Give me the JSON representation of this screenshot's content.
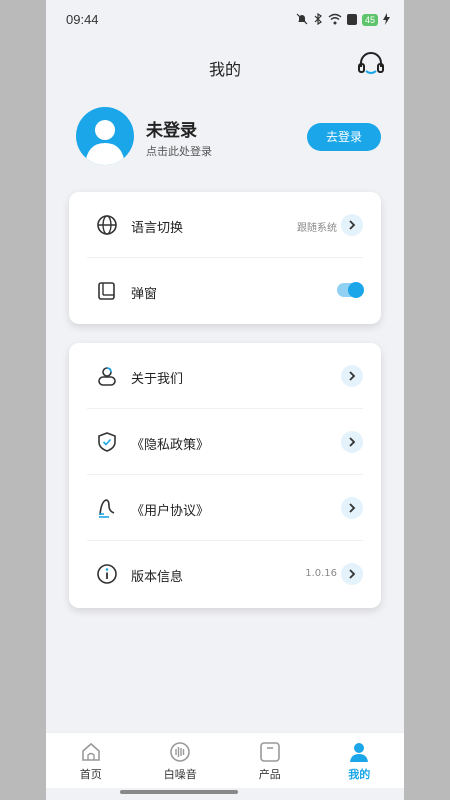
{
  "status_bar": {
    "time": "09:44",
    "battery": "45"
  },
  "header": {
    "title": "我的"
  },
  "user": {
    "name": "未登录",
    "subtitle": "点击此处登录",
    "login_button": "去登录"
  },
  "settings": {
    "language": {
      "label": "语言切换",
      "value": "跟随系统"
    },
    "popup": {
      "label": "弹窗",
      "enabled": true
    }
  },
  "info": {
    "about": {
      "label": "关于我们"
    },
    "privacy": {
      "label": "《隐私政策》"
    },
    "agreement": {
      "label": "《用户协议》"
    },
    "version": {
      "label": "版本信息",
      "value": "1.0.16"
    }
  },
  "tabs": [
    {
      "label": "首页",
      "icon": "home-icon",
      "active": false
    },
    {
      "label": "白噪音",
      "icon": "white-noise-icon",
      "active": false
    },
    {
      "label": "产品",
      "icon": "product-icon",
      "active": false
    },
    {
      "label": "我的",
      "icon": "profile-icon",
      "active": true
    }
  ],
  "colors": {
    "accent": "#1aa6e8",
    "background": "#f1f2f5",
    "card": "#ffffff"
  }
}
